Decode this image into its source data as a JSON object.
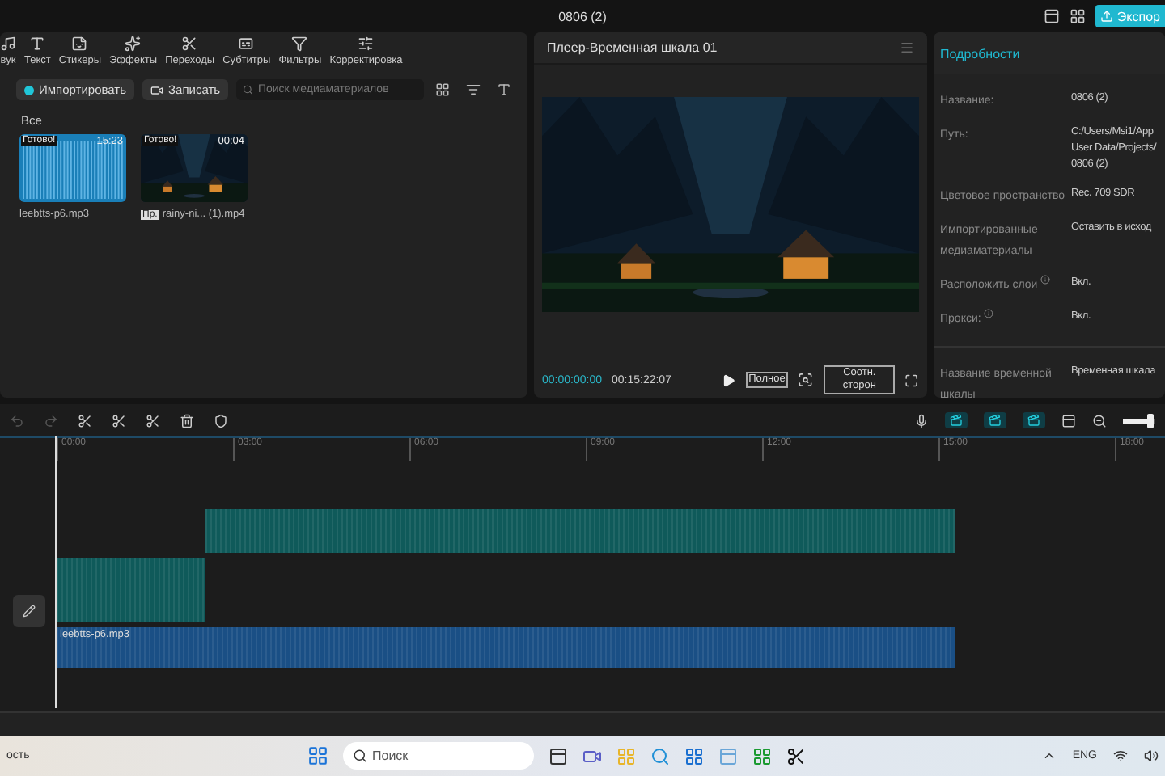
{
  "window": {
    "title": "0806 (2)"
  },
  "top_bar": {
    "export_button": "Экспор"
  },
  "media_tools": [
    {
      "label": "вук"
    },
    {
      "label": "Текст"
    },
    {
      "label": "Стикеры"
    },
    {
      "label": "Эффекты"
    },
    {
      "label": "Переходы"
    },
    {
      "label": "Субтитры"
    },
    {
      "label": "Фильтры"
    },
    {
      "label": "Корректировка"
    }
  ],
  "media": {
    "import_button": "Импортировать",
    "record_button": "Записать",
    "search": {
      "placeholder": "Поиск медиаматериалов"
    },
    "folder": "Все",
    "items": [
      {
        "kind": "audio",
        "status": "Готово!",
        "duration": "15:23",
        "name": "leebtts-p6.mp3"
      },
      {
        "kind": "video",
        "status": "Готово!",
        "duration": "00:04",
        "badge": "Пр.",
        "name": "rainy-ni... (1).mp4"
      }
    ]
  },
  "player": {
    "title": "Плеер-Временная шкала 01",
    "current_time": "00:00:00:00",
    "total_time": "00:15:22:07",
    "full_button": "Полное",
    "ratio_button": "Соотн. сторон"
  },
  "details": {
    "title": "Подробности",
    "rows": [
      {
        "label": "Название:",
        "value": [
          "0806 (2)"
        ],
        "info": false
      },
      {
        "label": "Путь:",
        "value": [
          "C:/Users/Msi1/App",
          "User Data/Projects/",
          "0806 (2)"
        ],
        "info": false
      },
      {
        "label": "Цветовое пространство",
        "value": [
          "Rec. 709 SDR"
        ],
        "info": false
      },
      {
        "label": "Импортированные медиаматериалы",
        "value": [
          "Оставить в исход"
        ],
        "info": false
      },
      {
        "label": "Расположить слои",
        "value": [
          "Вкл."
        ],
        "info": true
      },
      {
        "label": "Прокси:",
        "value": [
          "Вкл."
        ],
        "info": true
      },
      {
        "label": "Название временной шкалы",
        "value": [
          "Временная шкала"
        ],
        "info": false
      }
    ]
  },
  "timeline": {
    "ruler": [
      "00:00",
      "03:00",
      "06:00",
      "09:00",
      "12:00",
      "15:00",
      "18:00"
    ],
    "zoom": {
      "level": 0.85
    },
    "clips": [
      {
        "kind": "video"
      },
      {
        "kind": "video"
      },
      {
        "kind": "audio",
        "label": "leebtts-p6.mp3"
      }
    ]
  },
  "taskbar": {
    "left_text": "ость",
    "search_placeholder": "Поиск",
    "language": "ENG"
  }
}
